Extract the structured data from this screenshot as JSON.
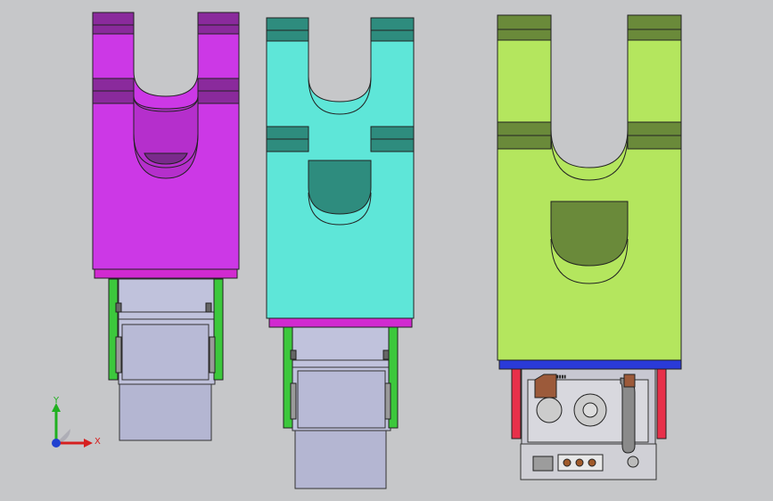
{
  "viewport": {
    "background": "#c6c7c9"
  },
  "models": [
    {
      "name": "magenta-gripper",
      "body_color": "#cc38e6",
      "pad_color": "#8a2a9c",
      "base_color": "#d12ad0",
      "rail_color": "#3cc83c"
    },
    {
      "name": "cyan-gripper",
      "body_color": "#5ee6d8",
      "pad_color": "#2e8c7e",
      "base_color": "#d12ad0",
      "rail_color": "#3cc83c"
    },
    {
      "name": "lime-gripper",
      "body_color": "#b4e65e",
      "pad_color": "#6a8a3a",
      "base_color": "#2a3ad8",
      "rail_color": "#e8304a"
    }
  ],
  "triad": {
    "x_label": "X",
    "y_label": "Y",
    "x_color": "#d62020",
    "y_color": "#20b020",
    "z_color": "#2040d0"
  }
}
